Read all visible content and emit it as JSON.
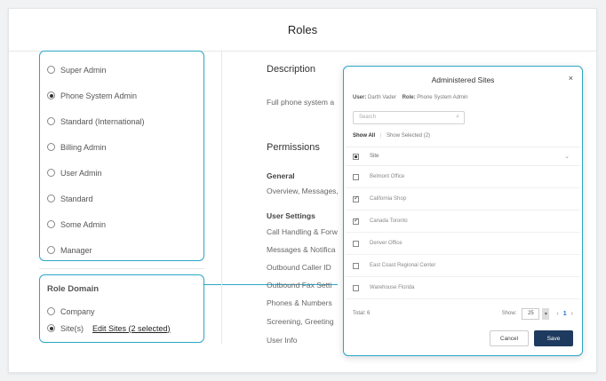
{
  "header": {
    "title": "Roles"
  },
  "roles": [
    {
      "label": "Super Admin",
      "selected": false
    },
    {
      "label": "Phone System Admin",
      "selected": true
    },
    {
      "label": "Standard (International)",
      "selected": false
    },
    {
      "label": "Billing Admin",
      "selected": false
    },
    {
      "label": "User Admin",
      "selected": false
    },
    {
      "label": "Standard",
      "selected": false
    },
    {
      "label": "Some Admin",
      "selected": false
    },
    {
      "label": "Manager",
      "selected": false
    }
  ],
  "role_domain": {
    "title": "Role Domain",
    "options": [
      {
        "label": "Company",
        "selected": false
      },
      {
        "label": "Site(s)",
        "selected": true
      }
    ],
    "edit_link": "Edit Sites (2 selected)"
  },
  "description": {
    "heading": "Description",
    "text": "Full phone system a"
  },
  "permissions": {
    "heading": "Permissions",
    "general_label": "General",
    "general_text": "Overview, Messages,",
    "user_settings_label": "User Settings",
    "items": [
      "Call Handling & Forw",
      "Messages & Notifica",
      "Outbound Caller ID",
      "Outbound Fax Setti",
      "Phones & Numbers",
      "Screening, Greeting",
      "User Info"
    ]
  },
  "modal": {
    "title": "Administered Sites",
    "close": "×",
    "user_label": "User:",
    "user_value": "Darth Vader",
    "role_label": "Role:",
    "role_value": "Phone System Admin",
    "search_placeholder": "Search",
    "filter_all": "Show All",
    "filter_selected": "Show Selected (2)",
    "column_site": "Site",
    "sites": [
      {
        "name": "Belmont Office",
        "checked": false
      },
      {
        "name": "California Shop",
        "checked": true
      },
      {
        "name": "Canada Toronto",
        "checked": true
      },
      {
        "name": "Denver Office",
        "checked": false
      },
      {
        "name": "East Coast Regional Center",
        "checked": false
      },
      {
        "name": "Warehouse Florida",
        "checked": false
      }
    ],
    "total_label": "Total: 6",
    "show_label": "Show:",
    "page_size": "25",
    "page_current": "1",
    "cancel_label": "Cancel",
    "save_label": "Save"
  },
  "colors": {
    "accent_border": "#2aa7c4",
    "save_button": "#1f3a5f",
    "pager_current": "#1a73c9"
  }
}
